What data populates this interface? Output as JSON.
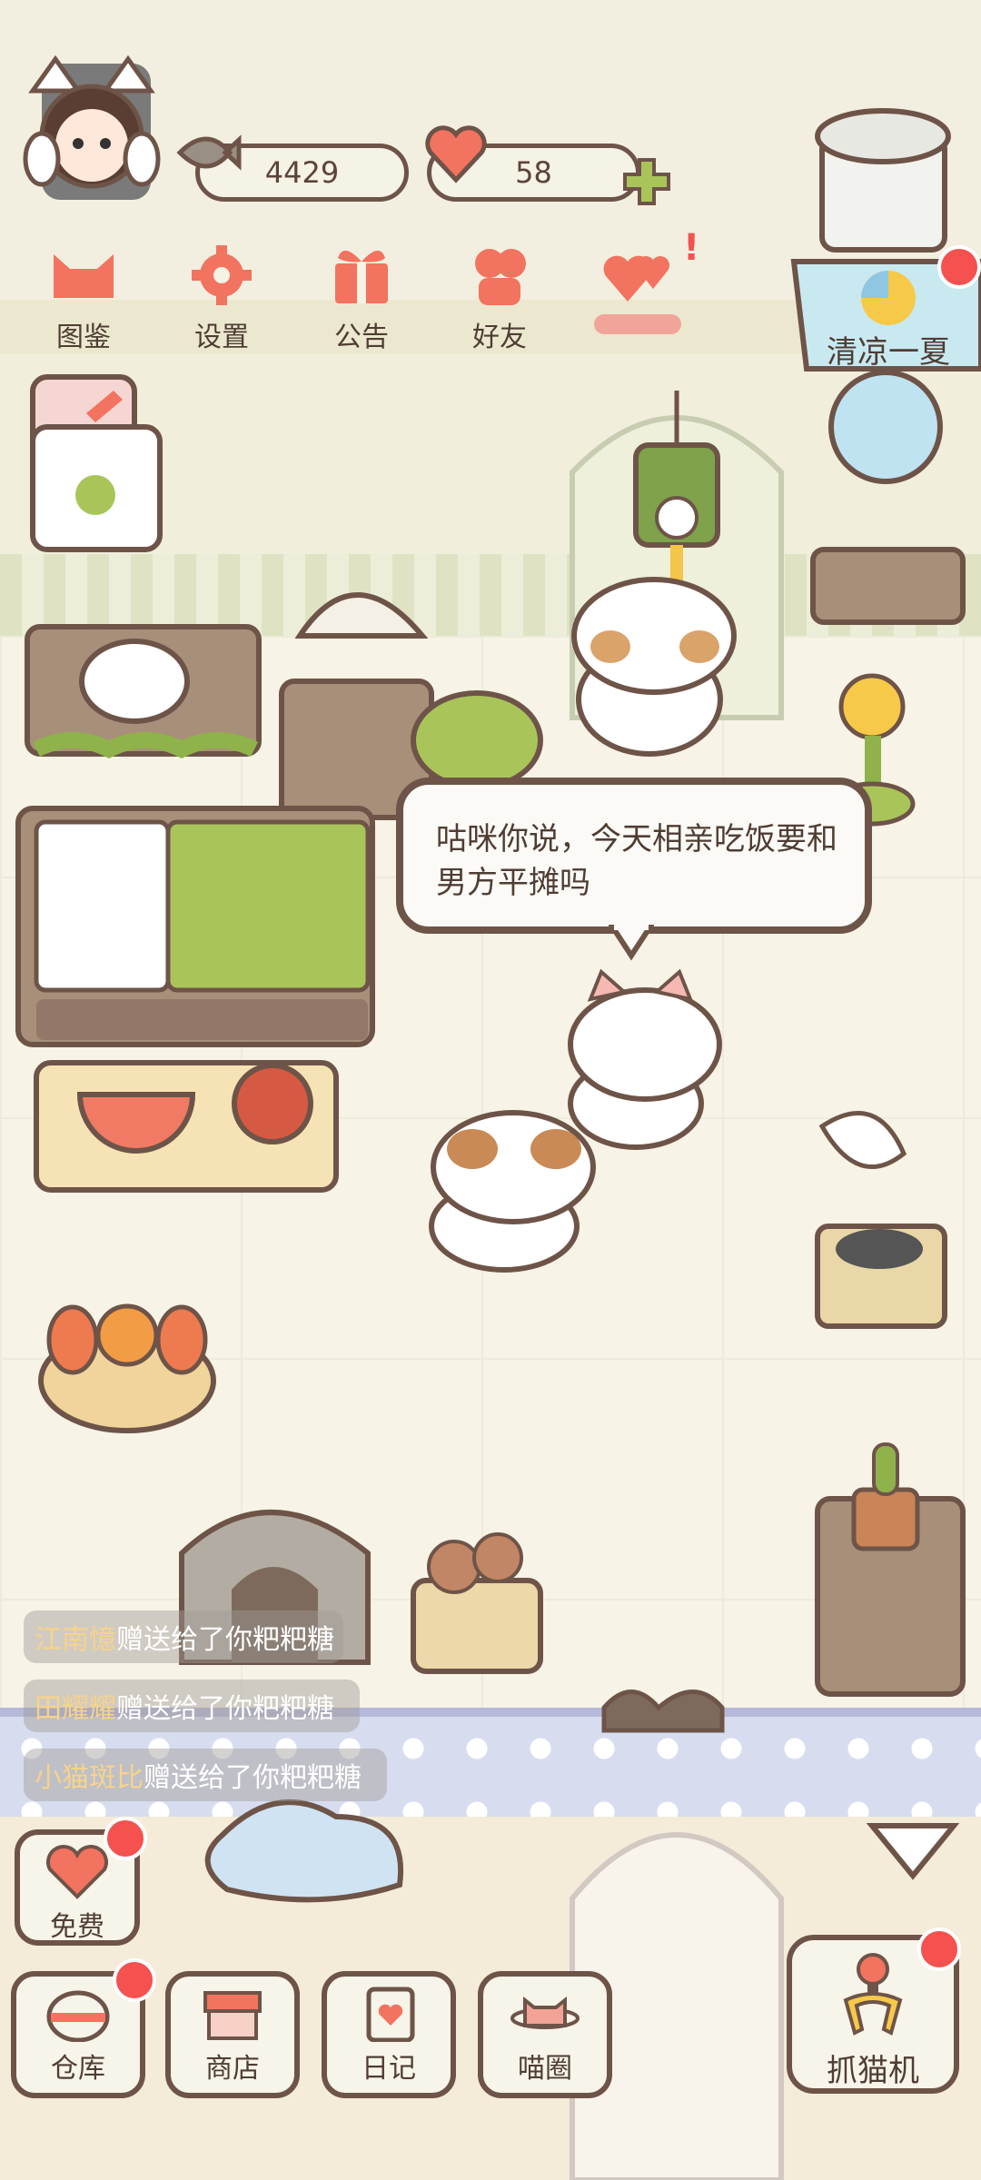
{
  "resources": {
    "fish_count": "4429",
    "heart_count": "58"
  },
  "top_menu": [
    {
      "label": "图鉴",
      "icon": "cat-face-icon"
    },
    {
      "label": "设置",
      "icon": "gear-icon"
    },
    {
      "label": "公告",
      "icon": "gift-icon"
    },
    {
      "label": "好友",
      "icon": "friends-icon"
    },
    {
      "label": "",
      "icon": "hearts-icon"
    }
  ],
  "event": {
    "name": "清凉一夏"
  },
  "speech_bubble": {
    "text": "咕咪你说，今天相亲吃饭要和男方平摊吗"
  },
  "gift_feed": [
    {
      "sender": "江南憶",
      "message": "赠送给了你粑粑糖"
    },
    {
      "sender": "田耀耀",
      "message": "赠送给了你粑粑糖"
    },
    {
      "sender": "小猫斑比",
      "message": "赠送给了你粑粑糖"
    }
  ],
  "bottom_menu": {
    "free": "免费",
    "warehouse": "仓库",
    "shop": "商店",
    "diary": "日记",
    "cat_circle": "喵圈",
    "claw_machine": "抓猫机"
  },
  "colors": {
    "outline": "#6e5448",
    "accent_red": "#f4514f",
    "icon_coral": "#f2735f",
    "leaf_green": "#a9c55a"
  }
}
